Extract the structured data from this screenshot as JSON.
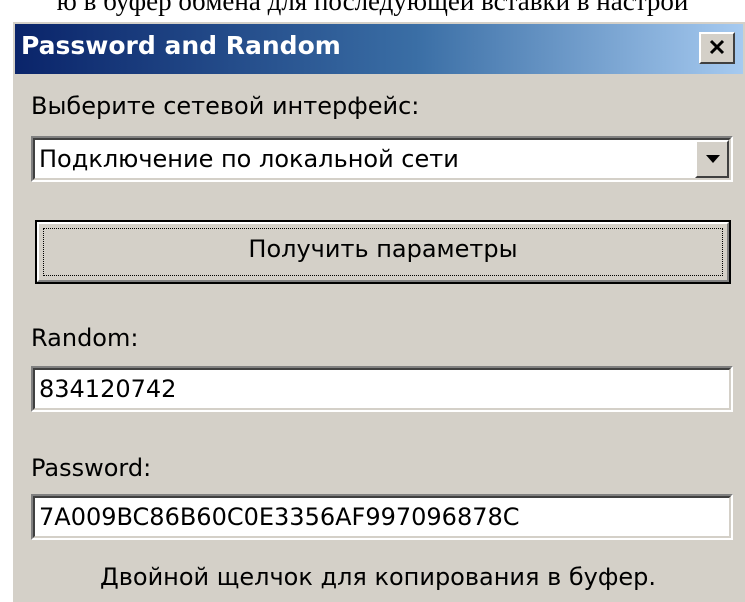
{
  "background": {
    "partial_text": "ю в буфер обмена для последующей вставки в настрой"
  },
  "window": {
    "title": "Password and Random",
    "close_glyph": "✕"
  },
  "interface": {
    "label": "Выберите сетевой интерфейс:",
    "selected": "Подключение по локальной сети",
    "arrow_icon": "chevron-down-icon"
  },
  "get_params_button": {
    "label": "Получить параметры"
  },
  "random": {
    "label": "Random:",
    "value": "834120742"
  },
  "password": {
    "label": "Password:",
    "value": "7A009BC86B60C0E3356AF997096878C"
  },
  "hint": "Двойной щелчок для копирования в буфер.",
  "colors": {
    "face": "#d4d0c8",
    "titlebar_start": "#0a246a",
    "titlebar_end": "#a6caf0",
    "title_text": "#ffffff"
  }
}
